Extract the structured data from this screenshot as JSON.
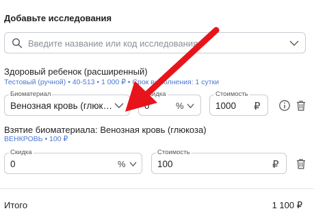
{
  "section_title": "Добавьте исследования",
  "search": {
    "placeholder": "Введите название или код исследования"
  },
  "items": [
    {
      "name": "Здоровый ребенок (расширенный)",
      "sub_left": "Тестовый (ручной) • 40-513 • 1 000 ₽",
      "sub_right": "Срок выполнения: 1 сутки",
      "biomaterial": {
        "label": "Биоматериал",
        "value": "Венозная кровь (глюкоза)"
      },
      "discount": {
        "label": "Скидка",
        "value": "0",
        "unit": "%"
      },
      "cost": {
        "label": "Стоимость",
        "value": "1000",
        "currency": "₽"
      }
    },
    {
      "name": "Взятие биоматериала: Венозная кровь (глюкоза)",
      "sub": "ВЕНКРОВЬ • 100 ₽",
      "discount": {
        "label": "Скидка",
        "value": "0",
        "unit": "%"
      },
      "cost": {
        "label": "Стоимость",
        "value": "100",
        "currency": "₽"
      }
    }
  ],
  "total": {
    "label": "Итого",
    "value": "1 100 ₽"
  },
  "colors": {
    "accent_link": "#4a78d0",
    "arrow": "#e8141b",
    "border": "#c8ccd2"
  },
  "icons": [
    "search-icon",
    "chevron-down-icon",
    "ruble-icon",
    "info-icon",
    "trash-icon",
    "annotation-arrow"
  ]
}
